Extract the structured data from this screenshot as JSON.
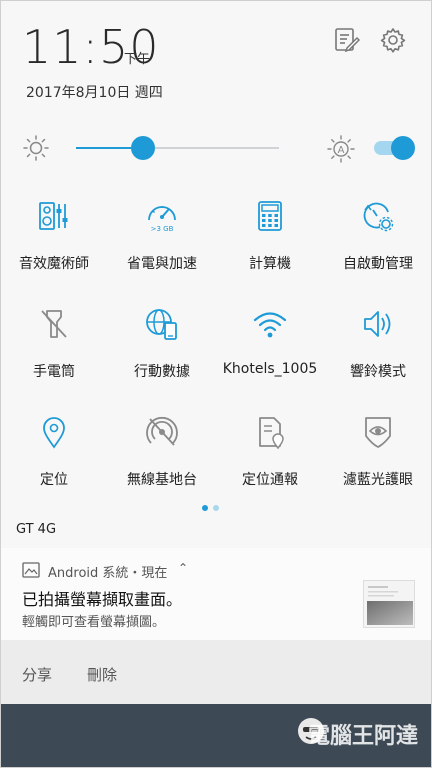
{
  "header": {
    "time": "11:50",
    "ampm": "下午",
    "date": "2017年8月10日 週四"
  },
  "brightness": {
    "level": 0.33,
    "auto": true
  },
  "tiles": [
    {
      "label": "音效魔術師",
      "icon": "audio-wizard-icon",
      "active": true
    },
    {
      "label": "省電與加速",
      "icon": "speedometer-icon",
      "active": true,
      "sub": ">3 GB"
    },
    {
      "label": "計算機",
      "icon": "calculator-icon",
      "active": true
    },
    {
      "label": "自啟動管理",
      "icon": "autostart-icon",
      "active": true
    },
    {
      "label": "手電筒",
      "icon": "flashlight-off-icon",
      "active": false
    },
    {
      "label": "行動數據",
      "icon": "mobile-data-icon",
      "active": true
    },
    {
      "label": "Khotels_1005",
      "icon": "wifi-icon",
      "active": true
    },
    {
      "label": "響鈴模式",
      "icon": "ringer-icon",
      "active": true
    },
    {
      "label": "定位",
      "icon": "location-icon",
      "active": true
    },
    {
      "label": "無線基地台",
      "icon": "hotspot-off-icon",
      "active": false
    },
    {
      "label": "定位通報",
      "icon": "location-report-icon",
      "active": false
    },
    {
      "label": "濾藍光護眼",
      "icon": "eye-filter-icon",
      "active": false
    }
  ],
  "carrier": "GT 4G",
  "notification": {
    "source": "Android 系統・現在",
    "title": "已拍攝螢幕擷取畫面。",
    "text": "輕觸即可查看螢幕擷圖。",
    "actions": [
      "分享",
      "刪除"
    ]
  },
  "colors": {
    "accent": "#1e9bd7",
    "inactive": "#8a8a8a",
    "bottom": "#3d4a56"
  },
  "watermark": "電腦王阿達"
}
